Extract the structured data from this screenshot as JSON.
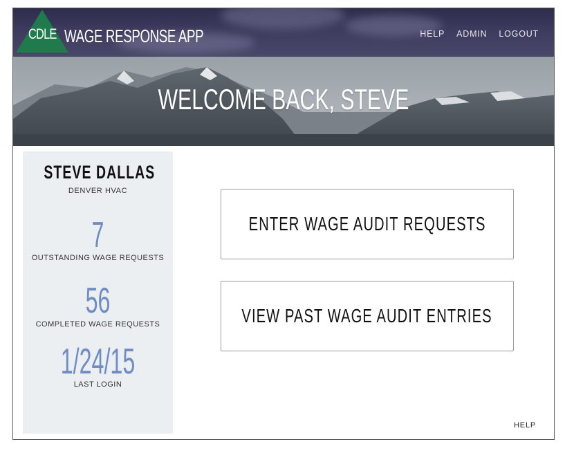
{
  "header": {
    "logo_text": "CDLE",
    "app_title": "WAGE RESPONSE APP",
    "nav": [
      "HELP",
      "ADMIN",
      "LOGOUT"
    ]
  },
  "hero": {
    "title": "WELCOME BACK, STEVE"
  },
  "sidebar": {
    "name": "STEVE DALLAS",
    "company": "DENVER HVAC",
    "stats": [
      {
        "value": "7",
        "label": "OUTSTANDING WAGE REQUESTS"
      },
      {
        "value": "56",
        "label": "COMPLETED WAGE REQUESTS"
      },
      {
        "value": "1/24/15",
        "label": "LAST LOGIN"
      }
    ]
  },
  "actions": {
    "enter": "ENTER WAGE AUDIT REQUESTS",
    "view": "VIEW PAST WAGE AUDIT ENTRIES"
  },
  "footer": {
    "help": "HELP"
  },
  "colors": {
    "logo_green": "#1f7a4c",
    "header_bg": "#3d3b5e",
    "accent_blue": "#6f8cc4",
    "sidebar_bg": "#ebeff2"
  }
}
